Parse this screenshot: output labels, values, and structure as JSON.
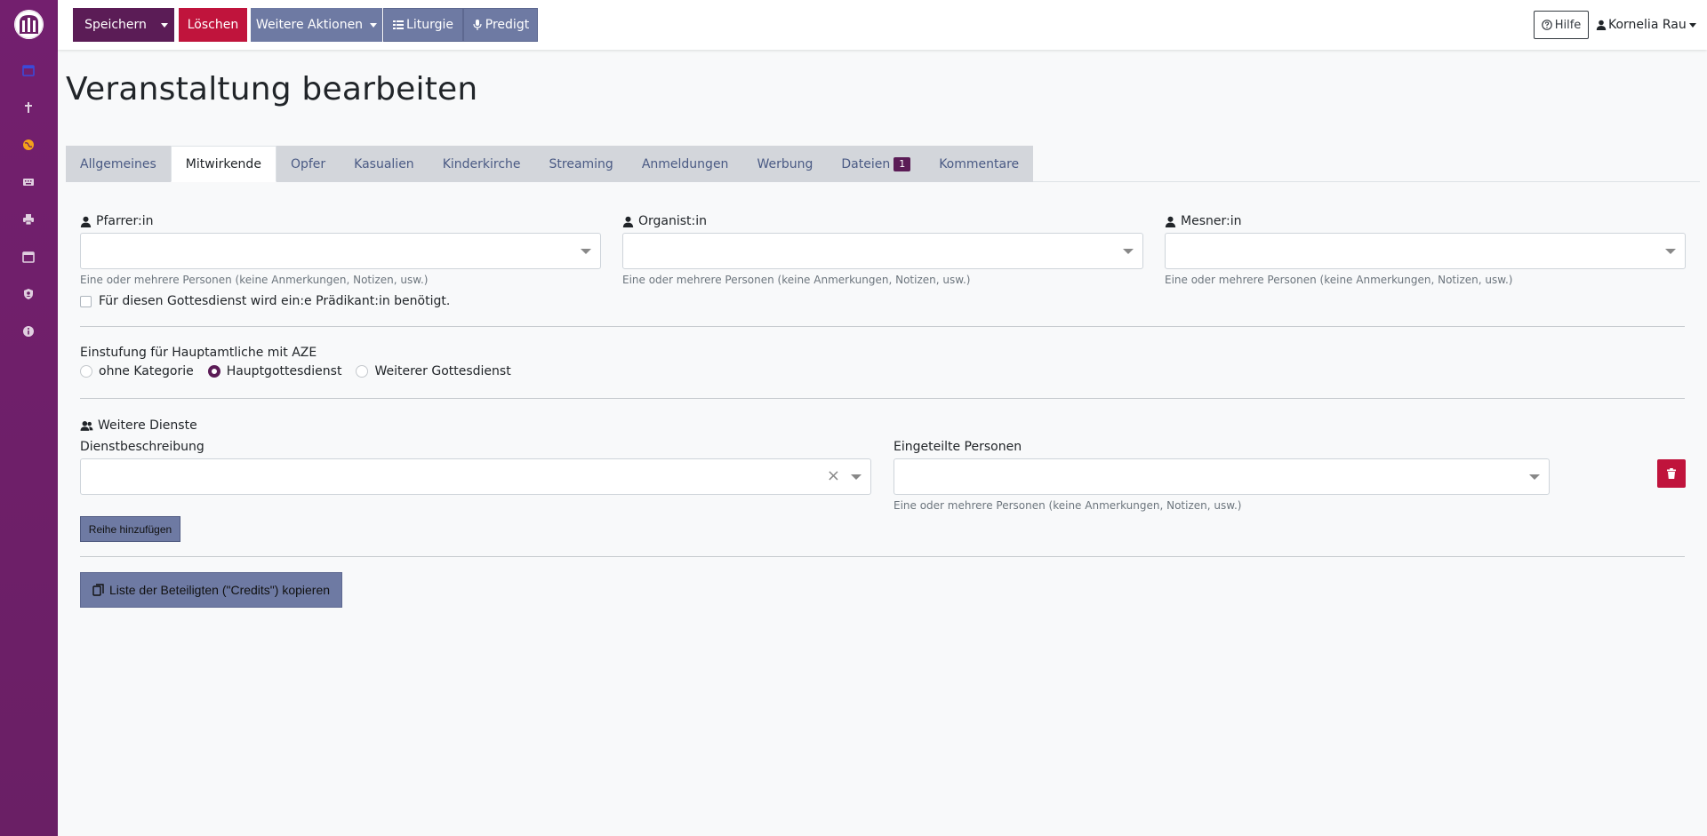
{
  "colors": {
    "sidebar": "#6b1f66",
    "primary": "#5b1c56",
    "danger": "#c0143c",
    "secondary": "#6e7aa3"
  },
  "sidebar": {
    "logo": "church-logo",
    "icons": [
      "calendar-icon",
      "cross-icon",
      "globe-icon",
      "keyboard-icon",
      "printer-icon",
      "calendar-icon",
      "user-shield-icon",
      "info-icon"
    ]
  },
  "toolbar": {
    "save_label": "Speichern",
    "delete_label": "Löschen",
    "more_actions_label": "Weitere Aktionen",
    "liturgy_label": "Liturgie",
    "sermon_label": "Predigt",
    "help_label": "Hilfe",
    "user_name": "Kornelia Rau"
  },
  "page": {
    "title": "Veranstaltung bearbeiten"
  },
  "tabs": [
    {
      "label": "Allgemeines"
    },
    {
      "label": "Mitwirkende",
      "active": true
    },
    {
      "label": "Opfer"
    },
    {
      "label": "Kasualien"
    },
    {
      "label": "Kinderkirche"
    },
    {
      "label": "Streaming"
    },
    {
      "label": "Anmeldungen"
    },
    {
      "label": "Werbung"
    },
    {
      "label": "Dateien",
      "badge": "1"
    },
    {
      "label": "Kommentare"
    }
  ],
  "form": {
    "pfarrer_label": "Pfarrer:in",
    "organist_label": "Organist:in",
    "mesner_label": "Mesner:in",
    "persons_help": "Eine oder mehrere Personen (keine Anmerkungen, Notizen, usw.)",
    "praedikant_label": "Für diesen Gottesdienst wird ein:e Prädikant:in benötigt.",
    "einstufung_label": "Einstufung für Hauptamtliche mit AZE",
    "radio": {
      "option1": "ohne Kategorie",
      "option2": "Hauptgottesdienst",
      "option3": "Weiterer Gottesdienst",
      "selected": "Hauptgottesdienst"
    },
    "weitere_dienste_label": "Weitere Dienste",
    "dienstbeschreibung_label": "Dienstbeschreibung",
    "eingeteilte_label": "Eingeteilte Personen",
    "add_row_label": "Reihe hinzufügen",
    "credits_label": "Liste der Beteiligten (\"Credits\") kopieren"
  }
}
